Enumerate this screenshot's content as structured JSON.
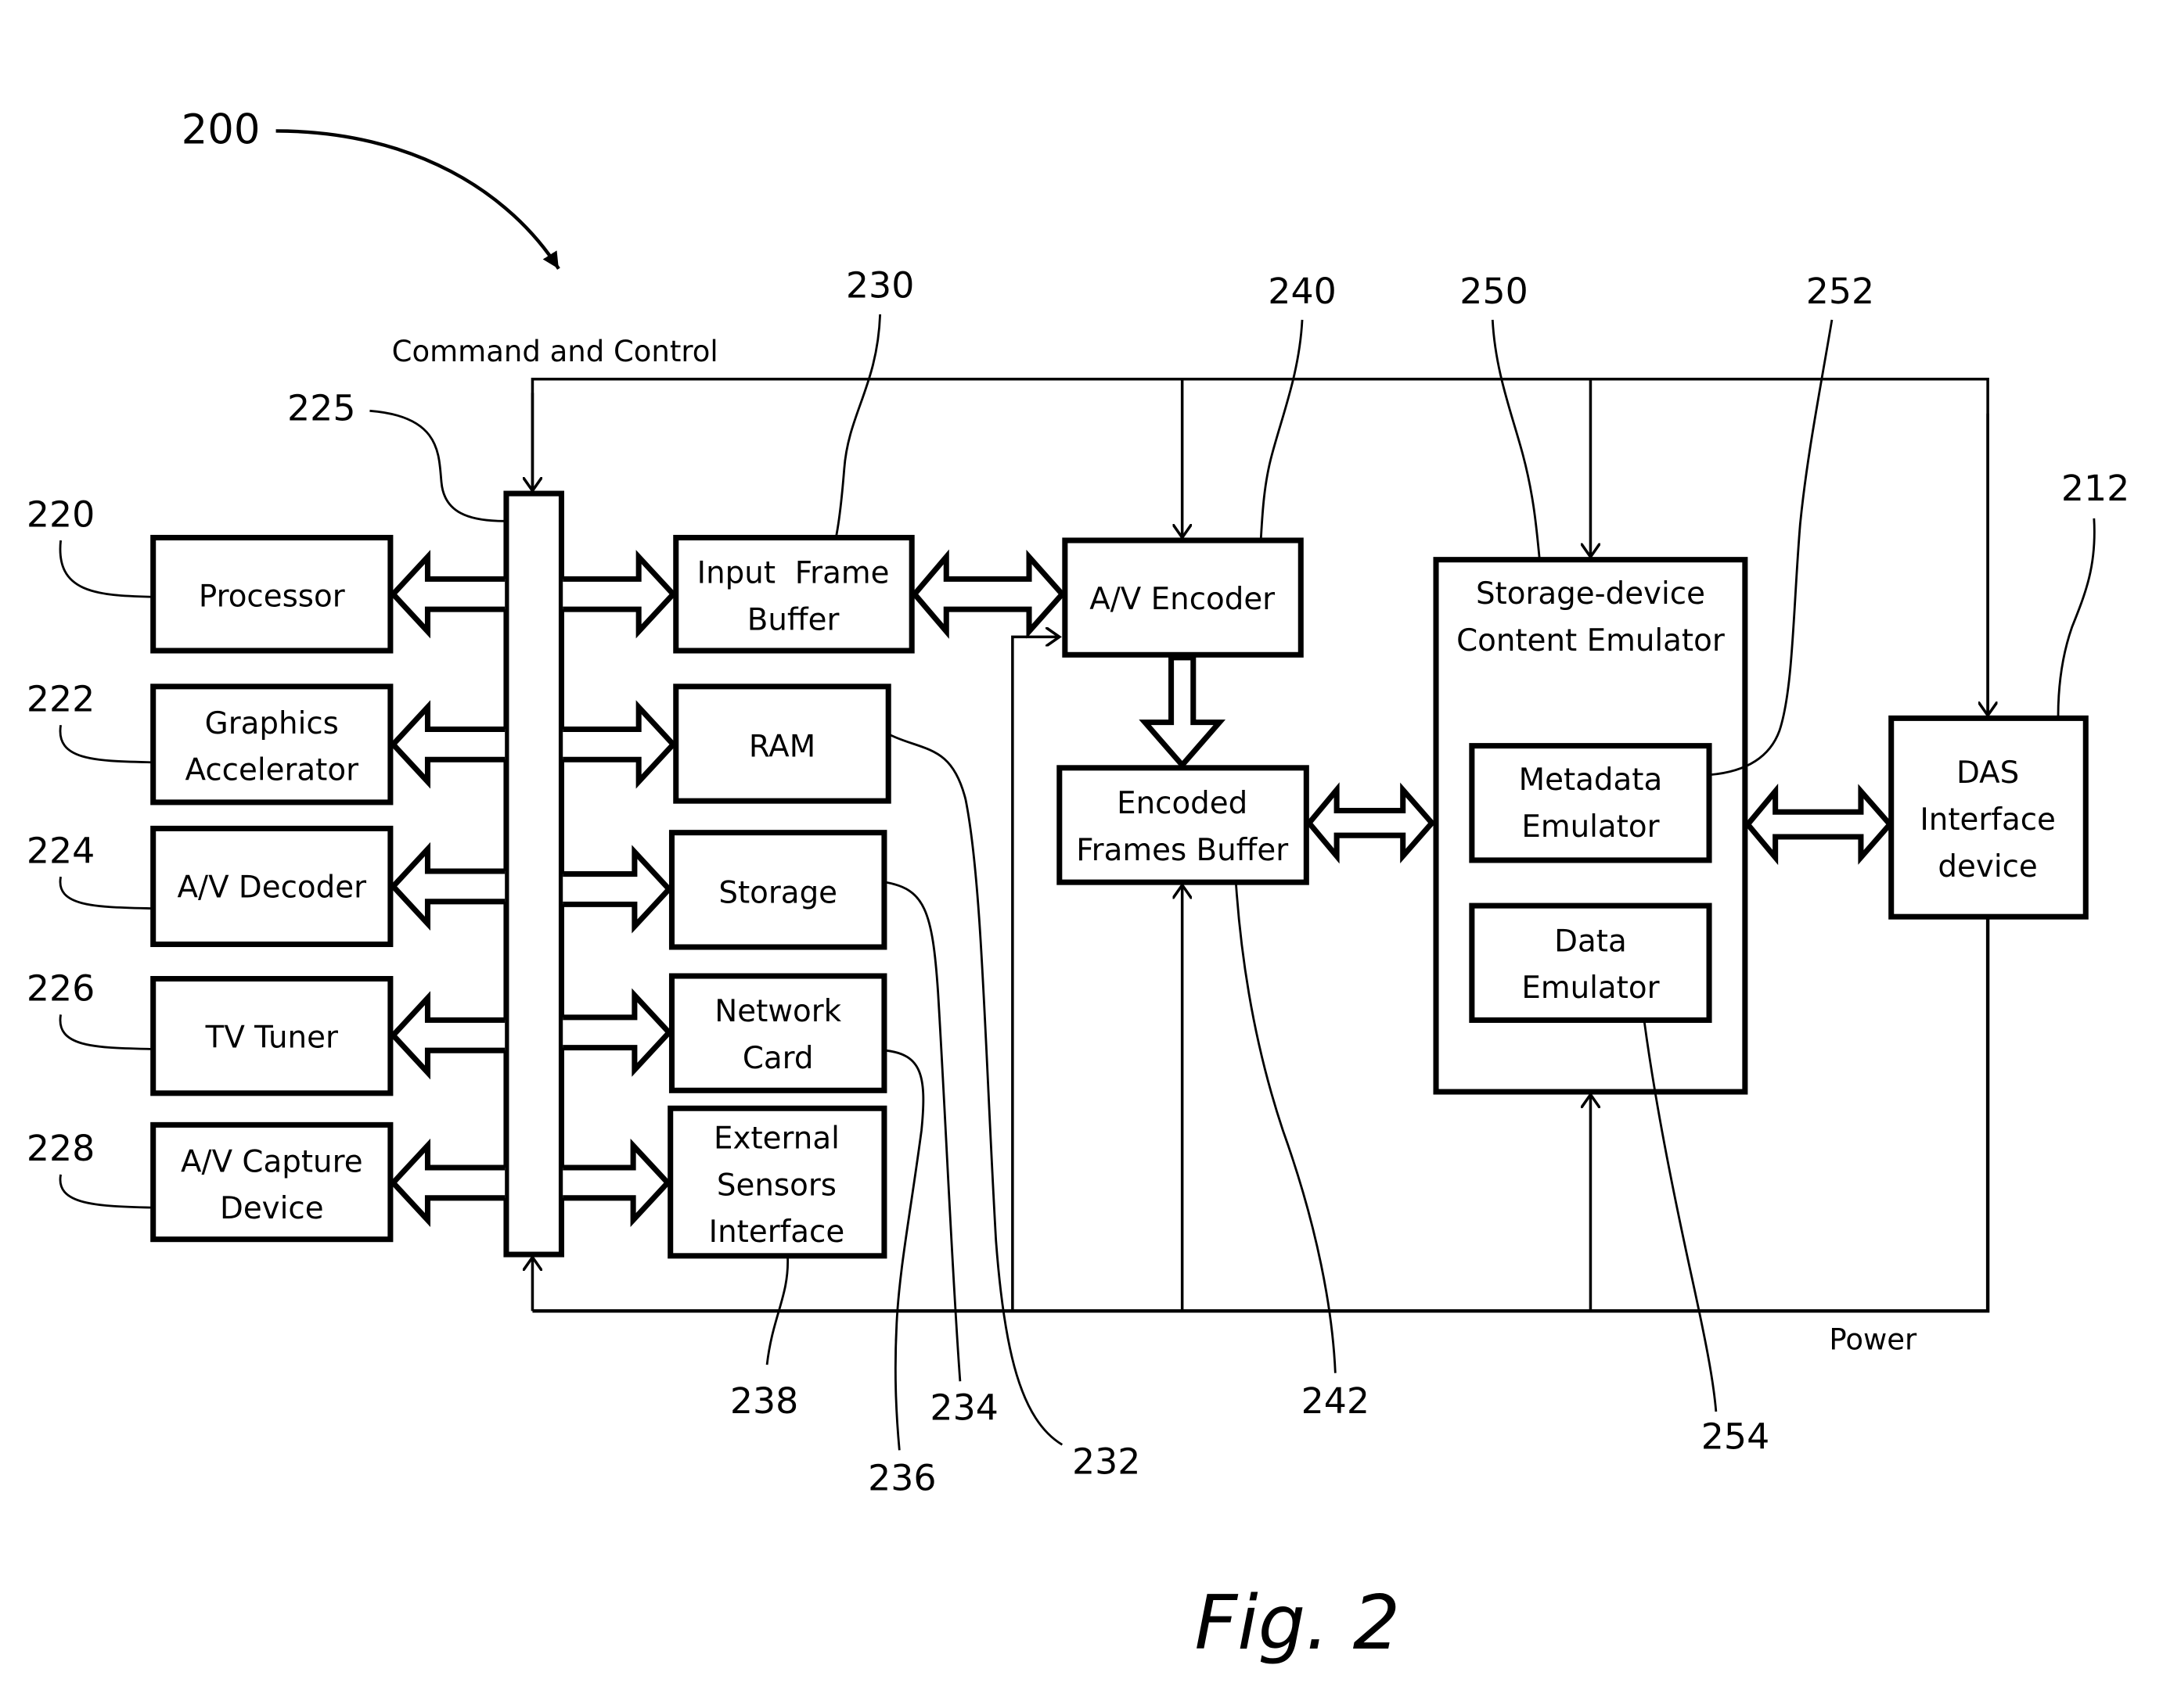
{
  "figure": {
    "number_label": "200",
    "caption": "Fig. 2"
  },
  "signals": {
    "command_and_control": "Command and Control",
    "power": "Power"
  },
  "bus": {
    "ref": "225"
  },
  "left_blocks": [
    {
      "ref": "220",
      "lines": [
        "Processor"
      ]
    },
    {
      "ref": "222",
      "lines": [
        "Graphics",
        "Accelerator"
      ]
    },
    {
      "ref": "224",
      "lines": [
        "A/V Decoder"
      ]
    },
    {
      "ref": "226",
      "lines": [
        "TV Tuner"
      ]
    },
    {
      "ref": "228",
      "lines": [
        "A/V Capture",
        "Device"
      ]
    }
  ],
  "right_blocks": [
    {
      "ref": "230",
      "lines": [
        "Input  Frame",
        "Buffer"
      ]
    },
    {
      "ref": "232",
      "lines": [
        "RAM"
      ]
    },
    {
      "ref": "234",
      "lines": [
        "Storage"
      ]
    },
    {
      "ref": "236",
      "lines": [
        "Network",
        "Card"
      ]
    },
    {
      "ref": "238",
      "lines": [
        "External",
        "Sensors",
        "Interface"
      ]
    }
  ],
  "encoder": {
    "ref": "240",
    "lines": [
      "A/V Encoder"
    ]
  },
  "encoded_buffer": {
    "ref": "242",
    "lines": [
      "Encoded",
      "Frames Buffer"
    ]
  },
  "emulator": {
    "ref": "250",
    "lines": [
      "Storage-device",
      "Content Emulator"
    ],
    "metadata": {
      "ref": "252",
      "lines": [
        "Metadata",
        "Emulator"
      ]
    },
    "data": {
      "ref": "254",
      "lines": [
        "Data",
        "Emulator"
      ]
    }
  },
  "das": {
    "ref": "212",
    "lines": [
      "DAS",
      "Interface",
      "device"
    ]
  }
}
